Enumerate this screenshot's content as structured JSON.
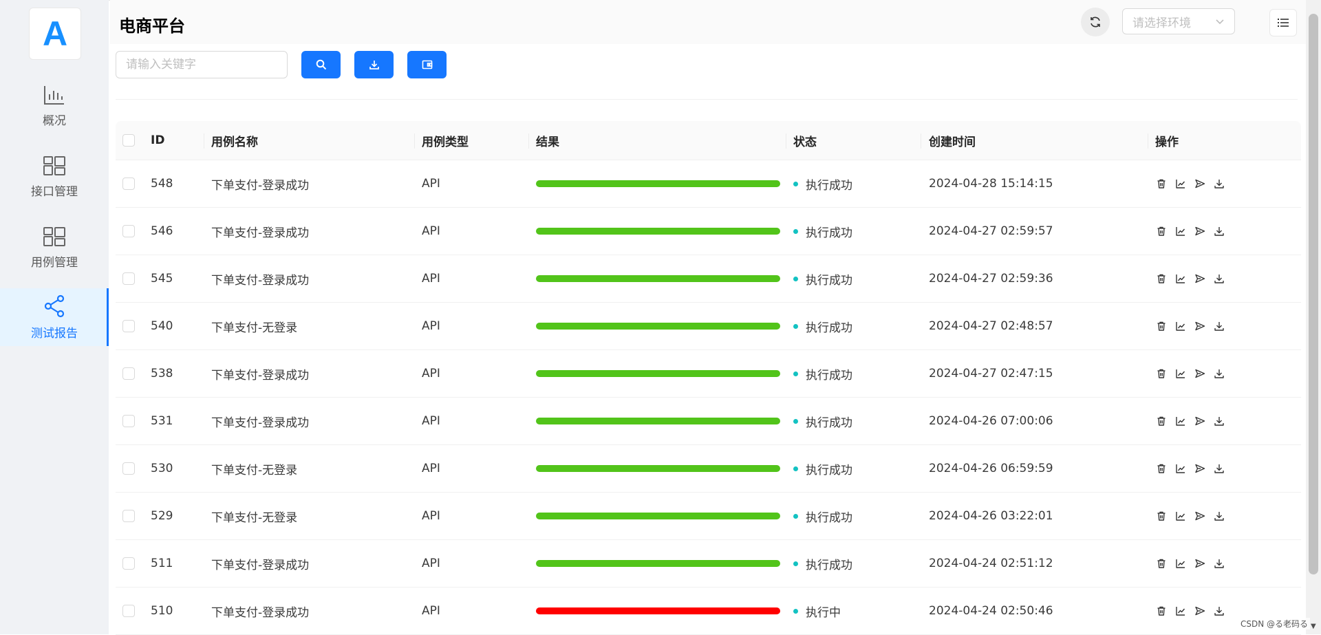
{
  "app": {
    "logo_letter": "A",
    "title": "电商平台",
    "accent_color": "#1677ff"
  },
  "sidebar": {
    "items": [
      {
        "label": "概况",
        "icon": "bar-chart-icon",
        "active": false
      },
      {
        "label": "接口管理",
        "icon": "dashboard-grid-icon",
        "active": false
      },
      {
        "label": "用例管理",
        "icon": "dashboard-grid-icon",
        "active": false
      },
      {
        "label": "测试报告",
        "icon": "share-icon",
        "active": true
      }
    ]
  },
  "header": {
    "refresh_icon": "refresh-icon",
    "env_placeholder": "请选择环境",
    "menu_icon": "list-menu-icon"
  },
  "toolbar": {
    "search_placeholder": "请输入关键字",
    "buttons": [
      {
        "icon": "search-icon"
      },
      {
        "icon": "download-icon"
      },
      {
        "icon": "wallet-icon"
      }
    ]
  },
  "table": {
    "columns": [
      "ID",
      "用例名称",
      "用例类型",
      "结果",
      "状态",
      "创建时间",
      "操作"
    ],
    "action_icons": [
      "delete-icon",
      "chart-icon",
      "send-icon",
      "download-icon"
    ],
    "rows": [
      {
        "id": "548",
        "name": "下单支付-登录成功",
        "type": "API",
        "result": 1.0,
        "result_color": "#52c41a",
        "status": "执行成功",
        "created": "2024-04-28 15:14:15"
      },
      {
        "id": "546",
        "name": "下单支付-登录成功",
        "type": "API",
        "result": 1.0,
        "result_color": "#52c41a",
        "status": "执行成功",
        "created": "2024-04-27 02:59:57"
      },
      {
        "id": "545",
        "name": "下单支付-登录成功",
        "type": "API",
        "result": 1.0,
        "result_color": "#52c41a",
        "status": "执行成功",
        "created": "2024-04-27 02:59:36"
      },
      {
        "id": "540",
        "name": "下单支付-无登录",
        "type": "API",
        "result": 1.0,
        "result_color": "#52c41a",
        "status": "执行成功",
        "created": "2024-04-27 02:48:57"
      },
      {
        "id": "538",
        "name": "下单支付-登录成功",
        "type": "API",
        "result": 1.0,
        "result_color": "#52c41a",
        "status": "执行成功",
        "created": "2024-04-27 02:47:15"
      },
      {
        "id": "531",
        "name": "下单支付-登录成功",
        "type": "API",
        "result": 1.0,
        "result_color": "#52c41a",
        "status": "执行成功",
        "created": "2024-04-26 07:00:06"
      },
      {
        "id": "530",
        "name": "下单支付-无登录",
        "type": "API",
        "result": 1.0,
        "result_color": "#52c41a",
        "status": "执行成功",
        "created": "2024-04-26 06:59:59"
      },
      {
        "id": "529",
        "name": "下单支付-无登录",
        "type": "API",
        "result": 1.0,
        "result_color": "#52c41a",
        "status": "执行成功",
        "created": "2024-04-26 03:22:01"
      },
      {
        "id": "511",
        "name": "下单支付-登录成功",
        "type": "API",
        "result": 1.0,
        "result_color": "#52c41a",
        "status": "执行成功",
        "created": "2024-04-24 02:51:12"
      },
      {
        "id": "510",
        "name": "下单支付-登录成功",
        "type": "API",
        "result": 1.0,
        "result_color": "#ff0000",
        "status": "执行中",
        "created": "2024-04-24 02:50:46"
      }
    ],
    "status_dot_color": "#13c2c2"
  },
  "watermark": "CSDN @る老码る"
}
